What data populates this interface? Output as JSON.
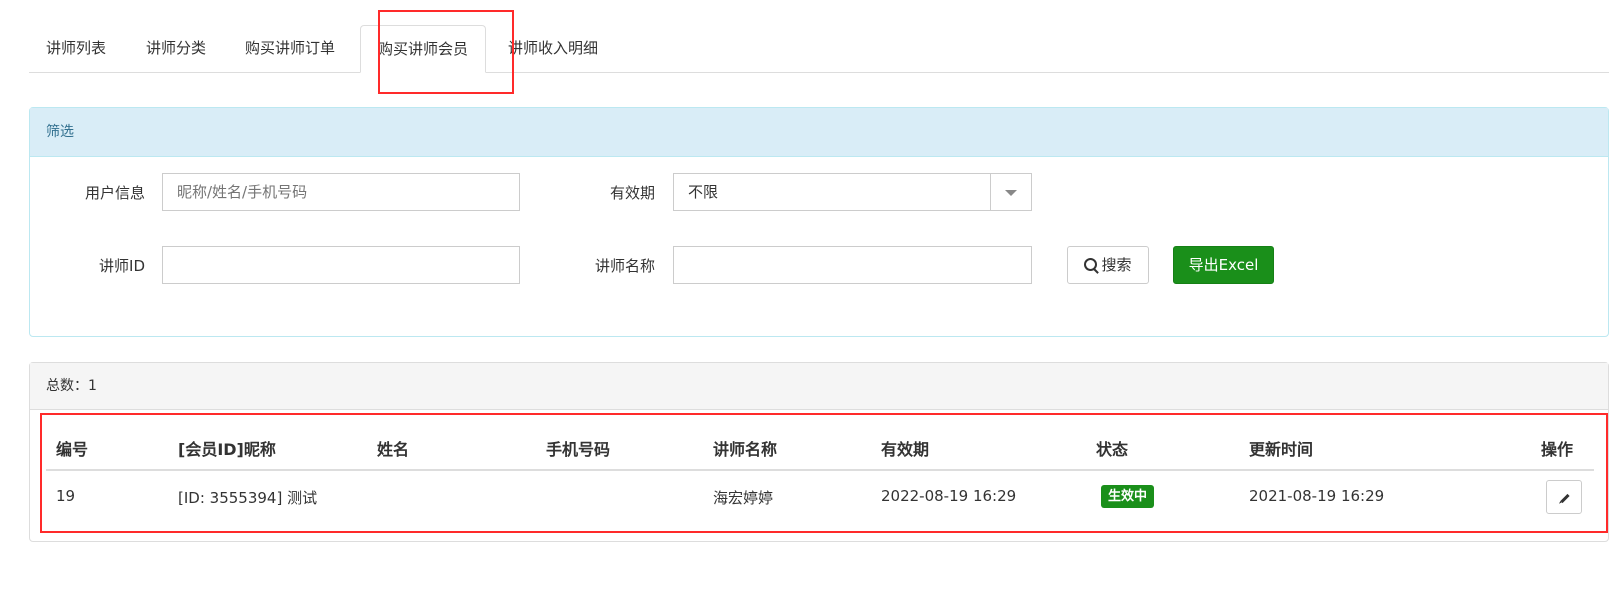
{
  "tabs": [
    {
      "label": "讲师列表"
    },
    {
      "label": "讲师分类"
    },
    {
      "label": "购买讲师订单"
    },
    {
      "label": "购买讲师会员"
    },
    {
      "label": "讲师收入明细"
    }
  ],
  "filter": {
    "title": "筛选",
    "user_info_label": "用户信息",
    "user_info_placeholder": "昵称/姓名/手机号码",
    "user_info_value": "",
    "validity_label": "有效期",
    "validity_value": "不限",
    "lecturer_id_label": "讲师ID",
    "lecturer_id_value": "",
    "lecturer_name_label": "讲师名称",
    "lecturer_name_value": "",
    "search_label": "搜索",
    "export_label": "导出Excel"
  },
  "list": {
    "total_label": "总数：1",
    "columns": [
      "编号",
      "[会员ID]昵称",
      "姓名",
      "手机号码",
      "讲师名称",
      "有效期",
      "状态",
      "更新时间",
      "操作"
    ],
    "rows": [
      {
        "id": "19",
        "member": "[ID: 3555394] 测试",
        "name": "",
        "phone": "",
        "lecturer": "海宏婷婷",
        "validity": "2022-08-19 16:29",
        "status": "生效中",
        "updated": "2021-08-19 16:29"
      }
    ]
  },
  "icons": {
    "search": "search-icon",
    "edit": "pencil-icon",
    "dropdown": "chevron-down-icon"
  },
  "colors": {
    "success": "#1a8f1a",
    "info_header": "#d9edf7",
    "highlight": "#ff2a2a"
  }
}
